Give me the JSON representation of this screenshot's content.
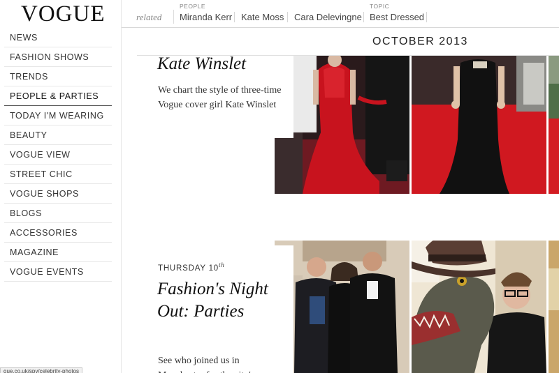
{
  "logo": "VOGUE",
  "nav": [
    {
      "label": "NEWS"
    },
    {
      "label": "FASHION SHOWS"
    },
    {
      "label": "TRENDS"
    },
    {
      "label": "PEOPLE & PARTIES"
    },
    {
      "label": "TODAY I'M WEARING"
    },
    {
      "label": "BEAUTY"
    },
    {
      "label": "VOGUE VIEW"
    },
    {
      "label": "STREET CHIC"
    },
    {
      "label": "VOGUE SHOPS"
    },
    {
      "label": "BLOGS"
    },
    {
      "label": "ACCESSORIES"
    },
    {
      "label": "MAGAZINE"
    },
    {
      "label": "VOGUE EVENTS"
    }
  ],
  "active_nav": "PEOPLE & PARTIES",
  "related": {
    "label": "related",
    "people_label": "PEOPLE",
    "people": [
      "Miranda Kerr",
      "Kate Moss",
      "Cara Delevingne"
    ],
    "topic_label": "TOPIC",
    "topics": [
      "Best Dressed"
    ]
  },
  "month_heading": "OCTOBER 2013",
  "articles": [
    {
      "title": "Kate Winslet",
      "description": "We chart the style of three-time Vogue cover girl Kate Winslet"
    },
    {
      "date_day": "THURSDAY 10",
      "date_suffix": "th",
      "title": "Fashion's Night Out: Parties",
      "description": "See who joined us in Manchester for the city's"
    }
  ],
  "status_bar_url": "gue.co.uk/spy/celebrity-photos",
  "colors": {
    "red_carpet": "#c1121c",
    "sidebar_divider": "#e7e7e7",
    "text": "#222222"
  }
}
